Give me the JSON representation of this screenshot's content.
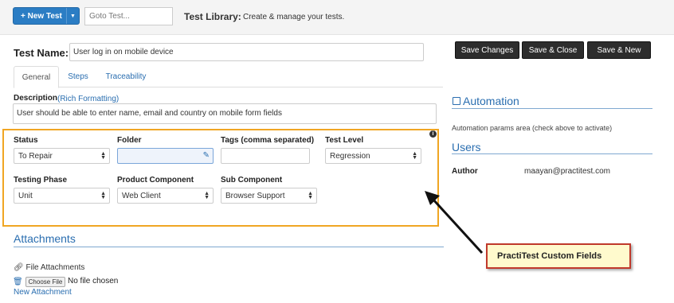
{
  "topbar": {
    "new_test_label": "+ New Test",
    "goto_placeholder": "Goto Test...",
    "library_title": "Test Library:",
    "library_subtitle": "Create & manage your tests."
  },
  "test": {
    "name_label": "Test Name:",
    "name_value": "User log in on mobile device"
  },
  "actions": {
    "save_changes": "Save Changes",
    "save_close": "Save & Close",
    "save_new": "Save & New"
  },
  "tabs": [
    {
      "label": "General",
      "active": true
    },
    {
      "label": "Steps",
      "active": false
    },
    {
      "label": "Traceability",
      "active": false
    }
  ],
  "description": {
    "label": "Description",
    "rich_link": "(Rich Formatting)",
    "value": "User should be able to enter name, email and country on mobile form fields"
  },
  "fields": {
    "status": {
      "label": "Status",
      "value": "To Repair"
    },
    "folder": {
      "label": "Folder",
      "value": ""
    },
    "tags": {
      "label": "Tags (comma separated)",
      "value": ""
    },
    "test_level": {
      "label": "Test Level",
      "value": "Regression"
    },
    "testing_phase": {
      "label": "Testing Phase",
      "value": "Unit"
    },
    "product_component": {
      "label": "Product Component",
      "value": "Web Client"
    },
    "sub_component": {
      "label": "Sub Component",
      "value": "Browser Support"
    }
  },
  "attachments": {
    "title": "Attachments",
    "file_label": "File Attachments",
    "choose_file": "Choose File",
    "no_file": "No file chosen",
    "new_link": "New Attachment"
  },
  "automation": {
    "title": "Automation",
    "note": "Automation params area (check above to activate)"
  },
  "users": {
    "title": "Users",
    "author_label": "Author",
    "author_value": "maayan@practitest.com"
  },
  "callout": {
    "text": "PractiTest Custom Fields"
  },
  "colors": {
    "primary": "#2b7dc4",
    "link": "#2a6eb0",
    "highlight_border": "#f0a623",
    "callout_border": "#c0392b",
    "callout_bg": "#fffacd",
    "dark_button": "#2d2d2d"
  }
}
